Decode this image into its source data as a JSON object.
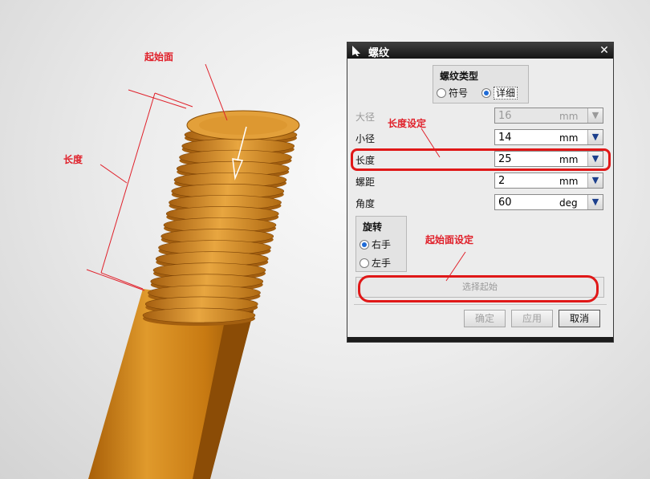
{
  "annotations": {
    "start_face": "起始面",
    "length": "长度",
    "length_setting": "长度设定",
    "start_face_setting": "起始面设定"
  },
  "dialog": {
    "title": "螺纹",
    "close_icon": "close-icon",
    "thread_type": {
      "title": "螺纹类型",
      "options": [
        "符号",
        "详细"
      ],
      "selected": "详细"
    },
    "fields": [
      {
        "label": "大径",
        "value": "16",
        "unit": "mm",
        "enabled": false
      },
      {
        "label": "小径",
        "value": "14",
        "unit": "mm",
        "enabled": true
      },
      {
        "label": "长度",
        "value": "25",
        "unit": "mm",
        "enabled": true
      },
      {
        "label": "螺距",
        "value": "2",
        "unit": "mm",
        "enabled": true
      },
      {
        "label": "角度",
        "value": "60",
        "unit": "deg",
        "enabled": true
      }
    ],
    "rotation": {
      "title": "旋转",
      "options": [
        "右手",
        "左手"
      ],
      "selected": "右手"
    },
    "select_start_button": "选择起始",
    "buttons": {
      "ok": "确定",
      "apply": "应用",
      "cancel": "取消"
    }
  },
  "colors": {
    "highlight": "#e01818",
    "annotation": "#e0202a",
    "bolt": "#d98a14"
  }
}
